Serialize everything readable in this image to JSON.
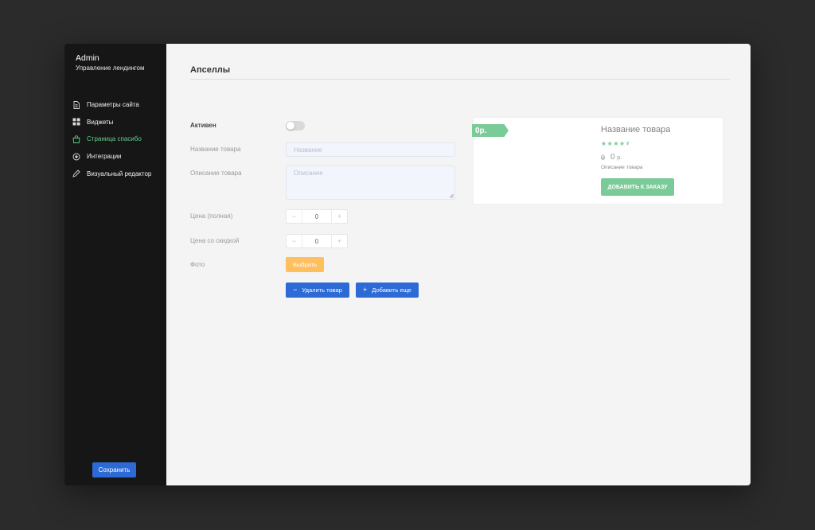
{
  "sidebar": {
    "brand_title": "Admin",
    "brand_subtitle": "Управление лендингом",
    "items": [
      {
        "label": "Параметры сайта",
        "icon": "document-icon",
        "active": false
      },
      {
        "label": "Виджеты",
        "icon": "grid-icon",
        "active": false
      },
      {
        "label": "Страница спасибо",
        "icon": "bag-icon",
        "active": true
      },
      {
        "label": "Интеграции",
        "icon": "integration-icon",
        "active": false
      },
      {
        "label": "Визуальный редактор",
        "icon": "pen-icon",
        "active": false
      }
    ],
    "save_label": "Сохранить"
  },
  "main": {
    "title": "Апселлы",
    "form": {
      "active_label": "Активен",
      "active_value": false,
      "name_label": "Название товара",
      "name_placeholder": "Название",
      "name_value": "",
      "description_label": "Описание товара",
      "description_placeholder": "Описание",
      "description_value": "",
      "full_price_label": "Цена (полная)",
      "full_price_value": "0",
      "discount_price_label": "Цена со скидкой",
      "discount_price_value": "0",
      "photo_label": "Фото",
      "choose_label": "Выбрать",
      "delete_label": "Удалить товар",
      "add_label": "Добавить еще"
    },
    "preview": {
      "price_tag": "0р.",
      "product_name": "Название товара",
      "rating": 4.5,
      "stars": "★★★★⯨",
      "old_price": "0",
      "new_price": "0",
      "currency": "р.",
      "description": "Описание товара",
      "order_label": "ДОБАВИТЬ К ЗАКАЗУ"
    }
  },
  "colors": {
    "background": "#2b2b2b",
    "sidebar": "#161616",
    "active_nav": "#5fcf8a",
    "primary": "#2d6ad6",
    "accent_orange": "#ffbf5e",
    "accent_green": "#7acb97"
  }
}
